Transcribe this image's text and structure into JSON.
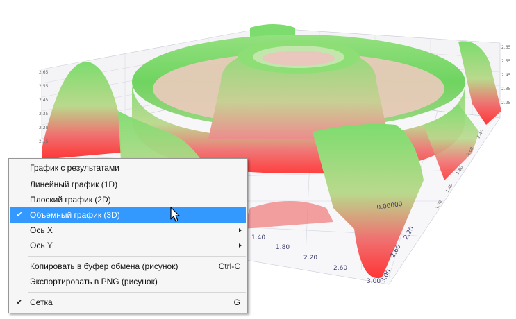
{
  "plot": {
    "axis_y_ticks": [
      "1.40",
      "1.80",
      "2.20",
      "2.60",
      "3.00"
    ],
    "axis_right_ticks": [
      "0.00000",
      "2.20",
      "2.60",
      "3.00"
    ],
    "surface_colors": {
      "high": "#7ddc6e",
      "low": "#ff3b3b",
      "mid": "#e8a07a"
    }
  },
  "menu": {
    "items": [
      {
        "label": "График с результатами",
        "checked": false,
        "submenu": false,
        "shortcut": ""
      },
      {
        "label": "Линейный график (1D)",
        "checked": false,
        "submenu": false,
        "shortcut": ""
      },
      {
        "label": "Плоский график (2D)",
        "checked": false,
        "submenu": false,
        "shortcut": ""
      },
      {
        "label": "Объемный график (3D)",
        "checked": true,
        "submenu": false,
        "shortcut": "",
        "highlighted": true
      },
      {
        "label": "Ось X",
        "checked": false,
        "submenu": true,
        "shortcut": ""
      },
      {
        "label": "Ось Y",
        "checked": false,
        "submenu": true,
        "shortcut": ""
      },
      {
        "label": "Копировать в буфер обмена (рисунок)",
        "checked": false,
        "submenu": false,
        "shortcut": "Ctrl-C"
      },
      {
        "label": "Экспортировать в PNG (рисунок)",
        "checked": false,
        "submenu": false,
        "shortcut": ""
      },
      {
        "label": "Сетка",
        "checked": true,
        "submenu": false,
        "shortcut": "G"
      }
    ],
    "check_glyph": "✔",
    "highlight_color": "#3399ff"
  }
}
